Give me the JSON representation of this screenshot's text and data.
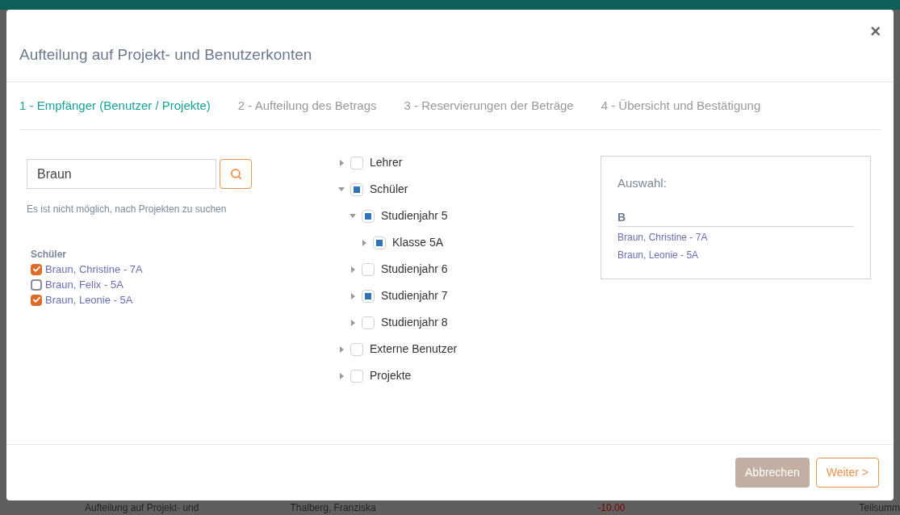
{
  "dialog": {
    "title": "Aufteilung auf Projekt- und Benutzerkonten",
    "close": "×"
  },
  "steps": [
    {
      "label": "1 - Empfänger (Benutzer / Projekte)",
      "selected": true
    },
    {
      "label": "2 - Aufteilung des Betrags",
      "selected": false
    },
    {
      "label": "3 - Reservierungen der Beträge",
      "selected": false
    },
    {
      "label": "4 - Übersicht und Bestätigung",
      "selected": false
    }
  ],
  "search": {
    "value": "Braun",
    "hint": "Es ist nicht möglich, nach Projekten zu suchen"
  },
  "results": {
    "heading": "Schüler",
    "items": [
      {
        "label": "Braun, Christine - 7A",
        "checked": true
      },
      {
        "label": "Braun, Felix - 5A",
        "checked": false
      },
      {
        "label": "Braun, Leonie - 5A",
        "checked": true
      }
    ]
  },
  "tree": [
    {
      "label": "Lehrer",
      "expanded": false,
      "partial": false
    },
    {
      "label": "Schüler",
      "expanded": true,
      "partial": true,
      "children": [
        {
          "label": "Studienjahr 5",
          "expanded": true,
          "partial": true,
          "children": [
            {
              "label": "Klasse 5A",
              "expanded": false,
              "partial": true
            }
          ]
        },
        {
          "label": "Studienjahr 6",
          "expanded": false,
          "partial": false
        },
        {
          "label": "Studienjahr 7",
          "expanded": false,
          "partial": true
        },
        {
          "label": "Studienjahr 8",
          "expanded": false,
          "partial": false
        }
      ]
    },
    {
      "label": "Externe Benutzer",
      "expanded": false,
      "partial": false
    },
    {
      "label": "Projekte",
      "expanded": false,
      "partial": false
    }
  ],
  "selection": {
    "heading": "Auswahl:",
    "group": "B",
    "items": [
      "Braun, Christine - 7A",
      "Braun, Leonie - 5A"
    ]
  },
  "buttons": {
    "cancel": "Abbrechen",
    "next": "Weiter >"
  },
  "background_row": [
    "Aufteilung auf Projekt- und",
    "Thalberg, Franziska",
    "-10.00",
    "Teilsumm"
  ]
}
